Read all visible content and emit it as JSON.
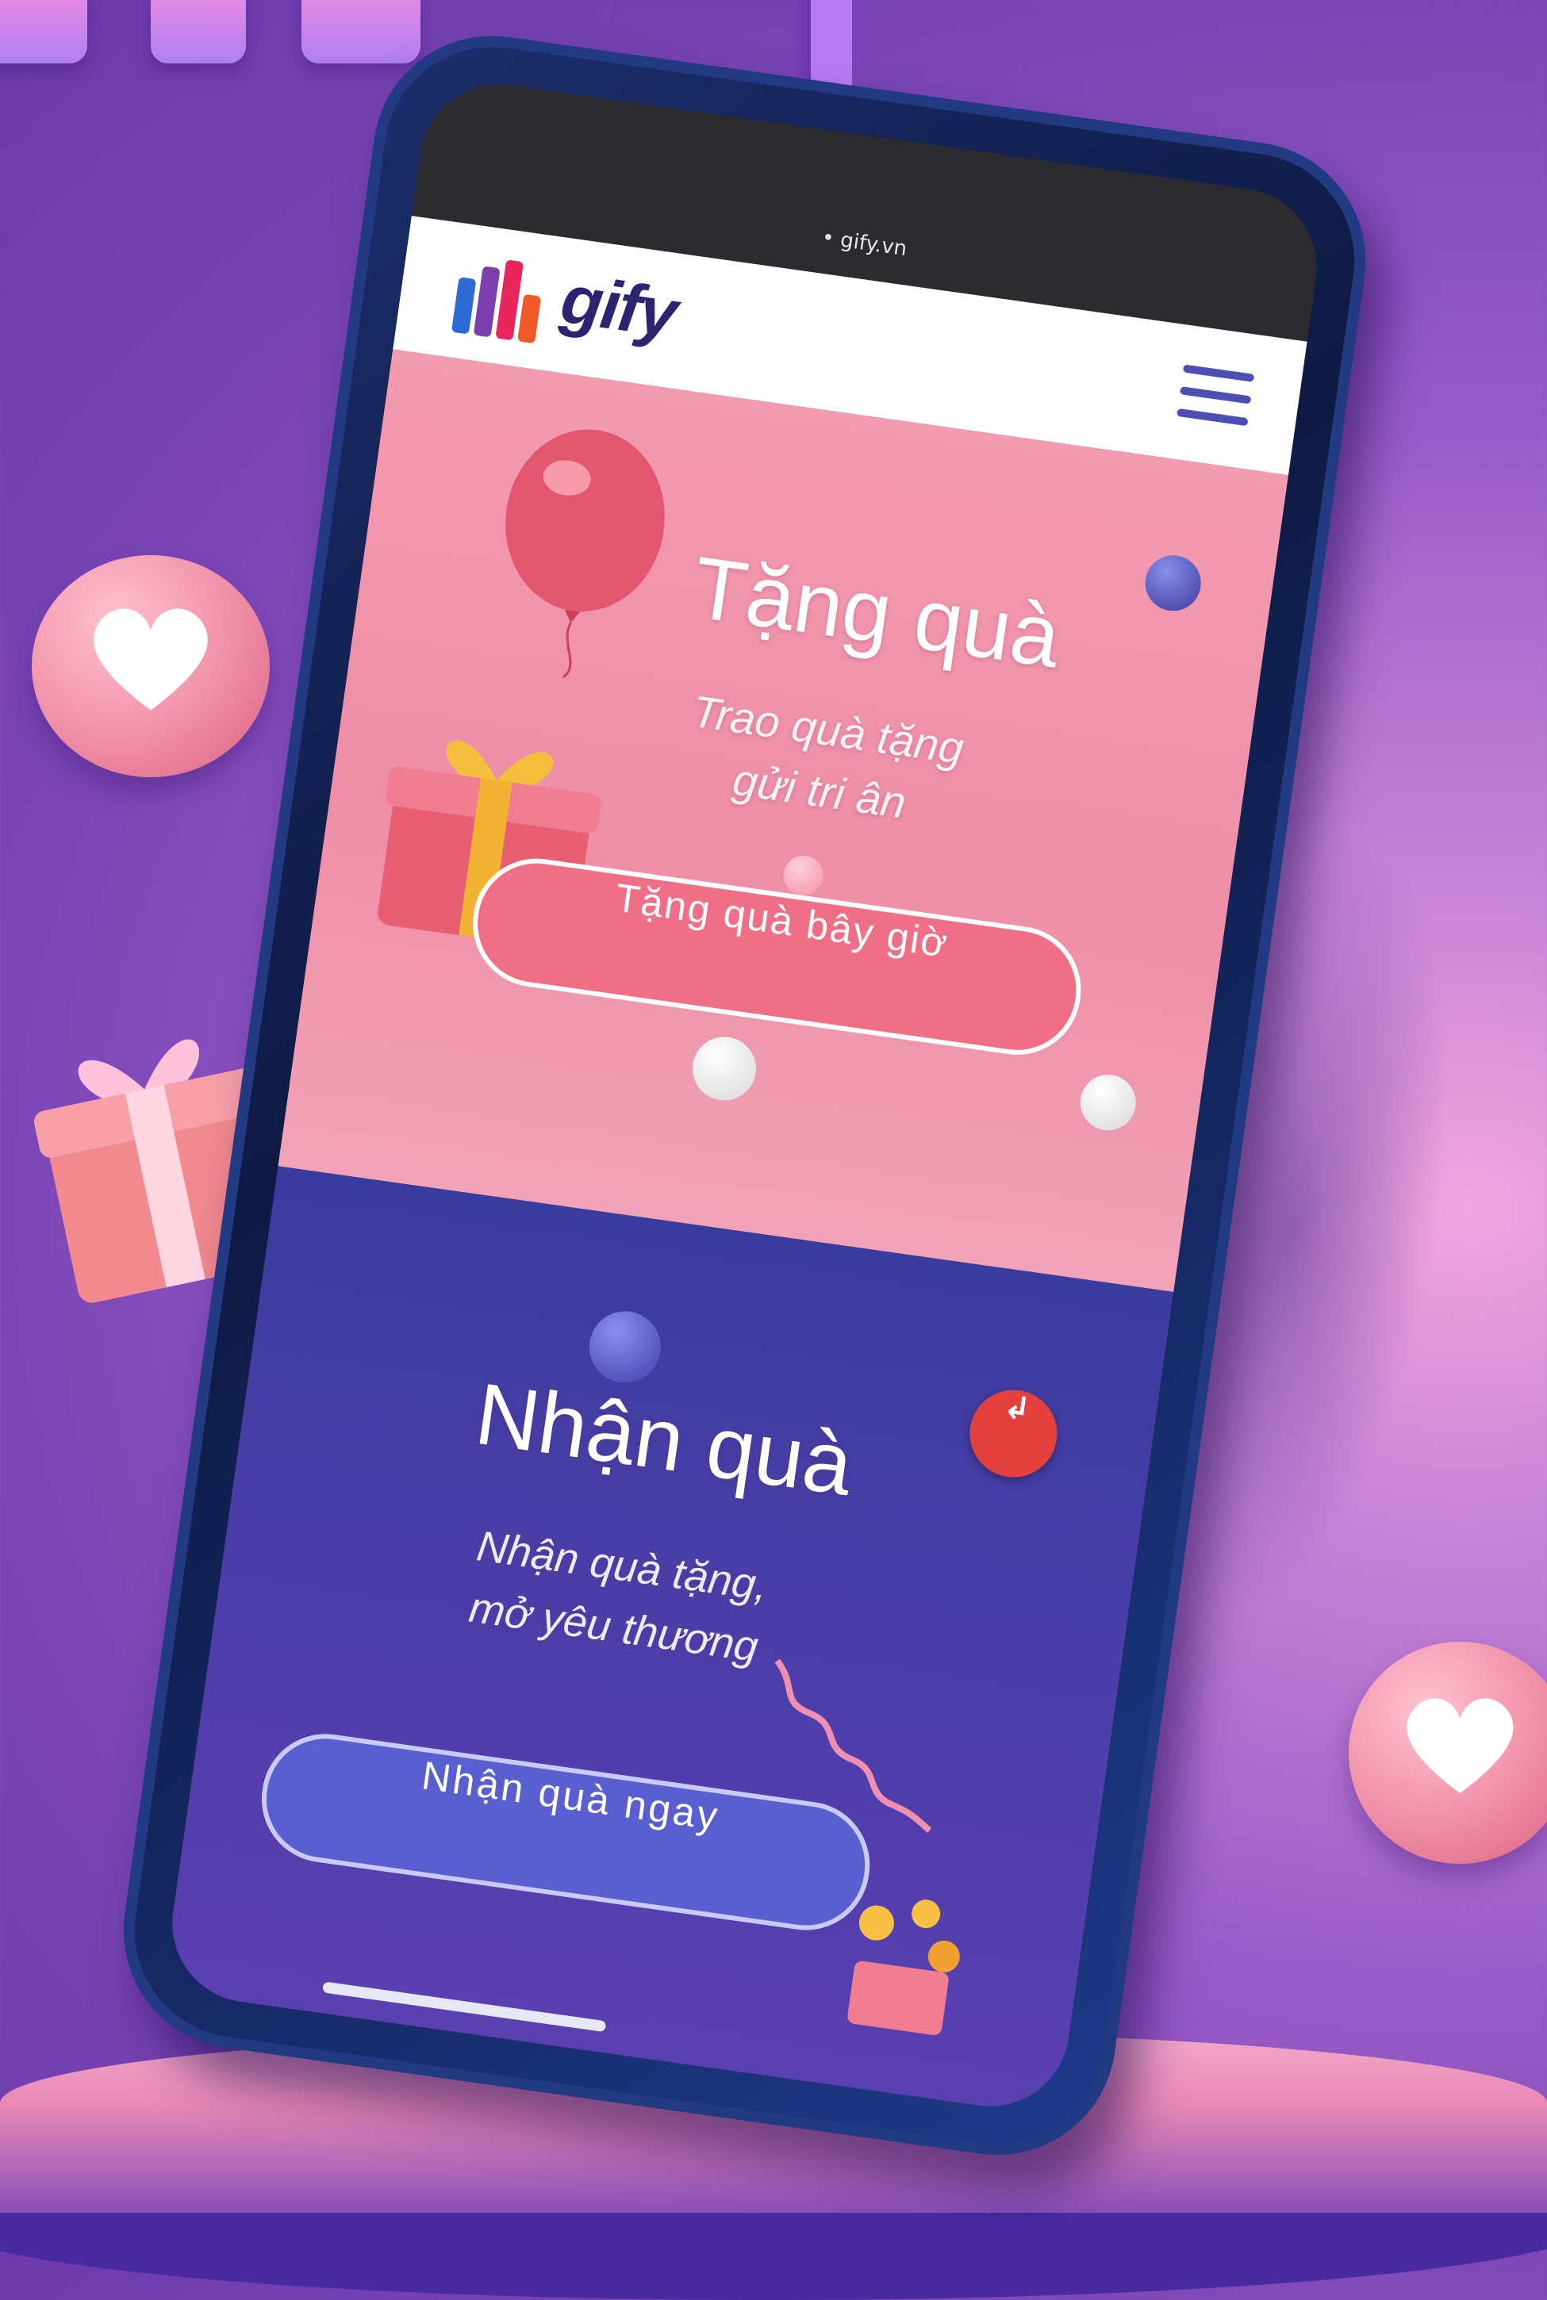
{
  "status_bar": {
    "text": "• gify.vn"
  },
  "app": {
    "logo_text": "gify",
    "brand_colors": [
      "#e8265b",
      "#f05a28",
      "#7b3fb0",
      "#2e6ad6",
      "#1e9ad6"
    ]
  },
  "menu": {
    "icon": "hamburger-menu-icon"
  },
  "gift_section": {
    "title": "Tặng quà",
    "subtitle_line1": "Trao quà tặng",
    "subtitle_line2": "gửi tri ân",
    "button_label": "Tặng quà bây giờ",
    "background": "#ee8ea7"
  },
  "receive_section": {
    "title": "Nhận quà",
    "subtitle_line1": "Nhận quà tặng,",
    "subtitle_line2": "mở yêu thương",
    "button_label": "Nhận quà ngay",
    "background": "#4a3ea8"
  },
  "floating_button": {
    "icon": "login-icon",
    "label": "↲"
  }
}
